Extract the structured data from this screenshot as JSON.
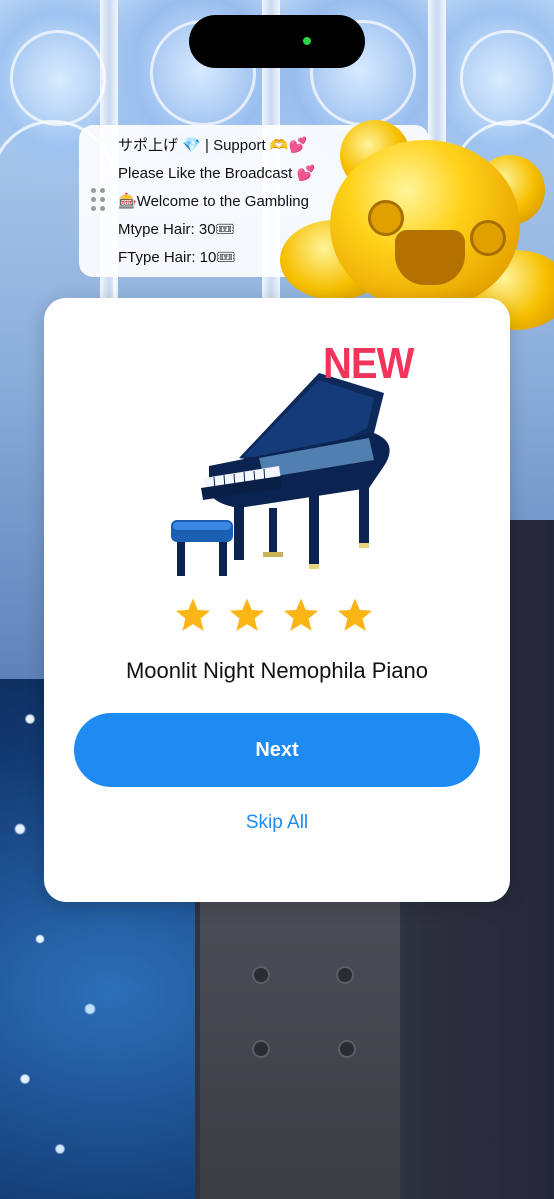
{
  "chat": {
    "lines": [
      "サポ上げ 💎 | Support 🫶💕",
      "Please Like the Broadcast 💕",
      "🎰Welcome to the Gambling",
      "Mtype Hair: 30🎟",
      "FType Hair: 10🎟"
    ]
  },
  "reward": {
    "badge": "NEW",
    "rating": 4,
    "item_name": "Moonlit Night Nemophila Piano",
    "next_label": "Next",
    "skip_label": "Skip All"
  },
  "colors": {
    "accent": "#1d8bf1",
    "star": "#fbb515",
    "badge": "#f0345a"
  }
}
